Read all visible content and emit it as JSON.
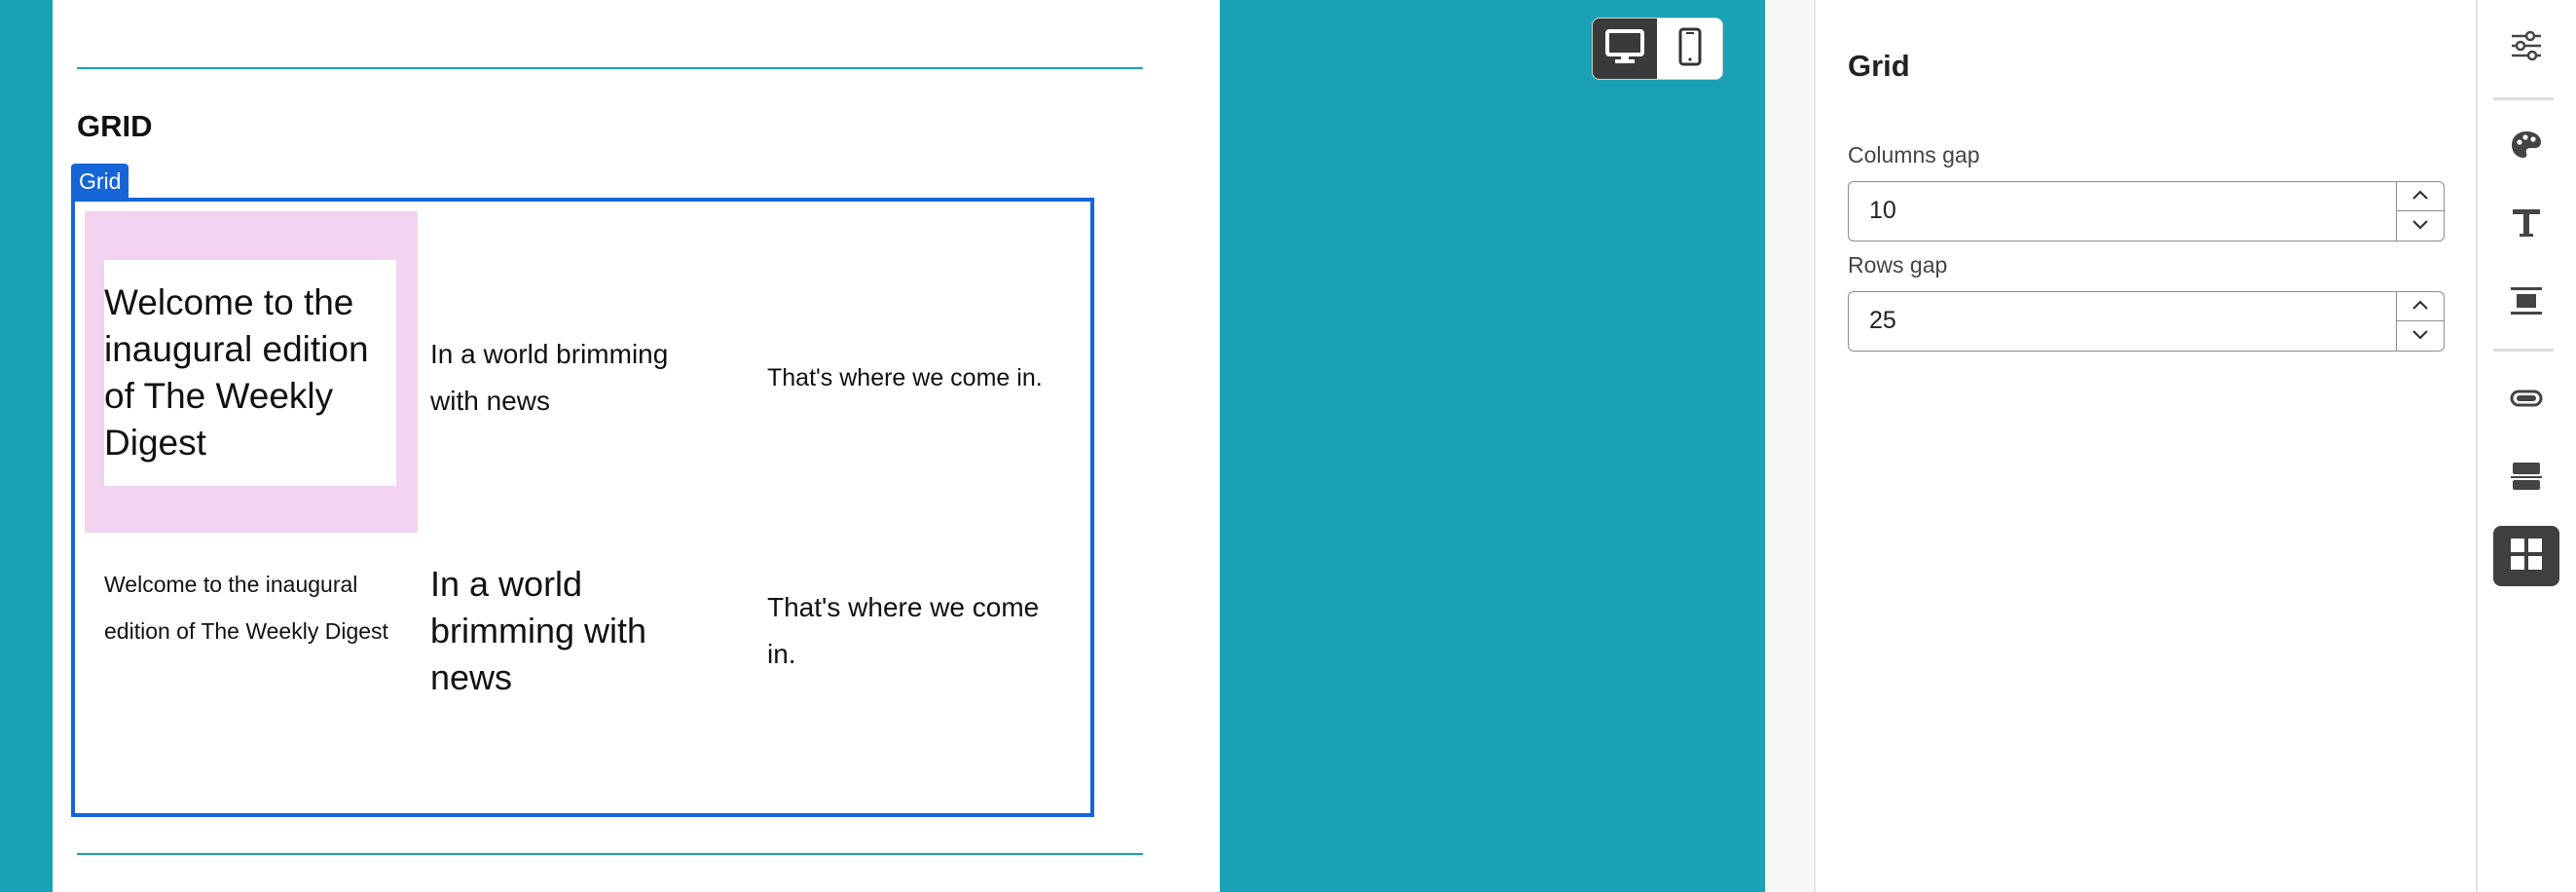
{
  "canvas": {
    "section_title": "GRID",
    "grid_tag": "Grid",
    "grid_cells": [
      {
        "text": "Welcome to the inaugural edition of The Weekly Digest",
        "selected": true
      },
      {
        "text": "In a world brimming with news"
      },
      {
        "text": "That's where we come in."
      },
      {
        "text": "Welcome to the inaugural edition of The Weekly Digest"
      },
      {
        "text": "In a world brimming with news"
      },
      {
        "text": "That's where we come in."
      }
    ]
  },
  "device_toggle": {
    "options": [
      {
        "icon": "desktop-icon",
        "active": true
      },
      {
        "icon": "mobile-icon",
        "active": false
      }
    ]
  },
  "properties_panel": {
    "title": "Grid",
    "columns_gap": {
      "label": "Columns gap",
      "value": "10"
    },
    "rows_gap": {
      "label": "Rows gap",
      "value": "25"
    }
  },
  "icon_rail": {
    "items": [
      {
        "icon": "settings-sliders-icon"
      },
      {
        "icon": "palette-icon"
      },
      {
        "icon": "text-icon"
      },
      {
        "icon": "align-block-icon"
      },
      {
        "icon": "button-icon"
      },
      {
        "icon": "container-icon"
      },
      {
        "icon": "grid-icon",
        "active": true
      }
    ]
  },
  "colors": {
    "canvas_background": "#1ba1b4",
    "selection_blue": "#1565d8",
    "cell_highlight": "#f2d3f0",
    "active_icon_bg": "#3f3f3f"
  }
}
